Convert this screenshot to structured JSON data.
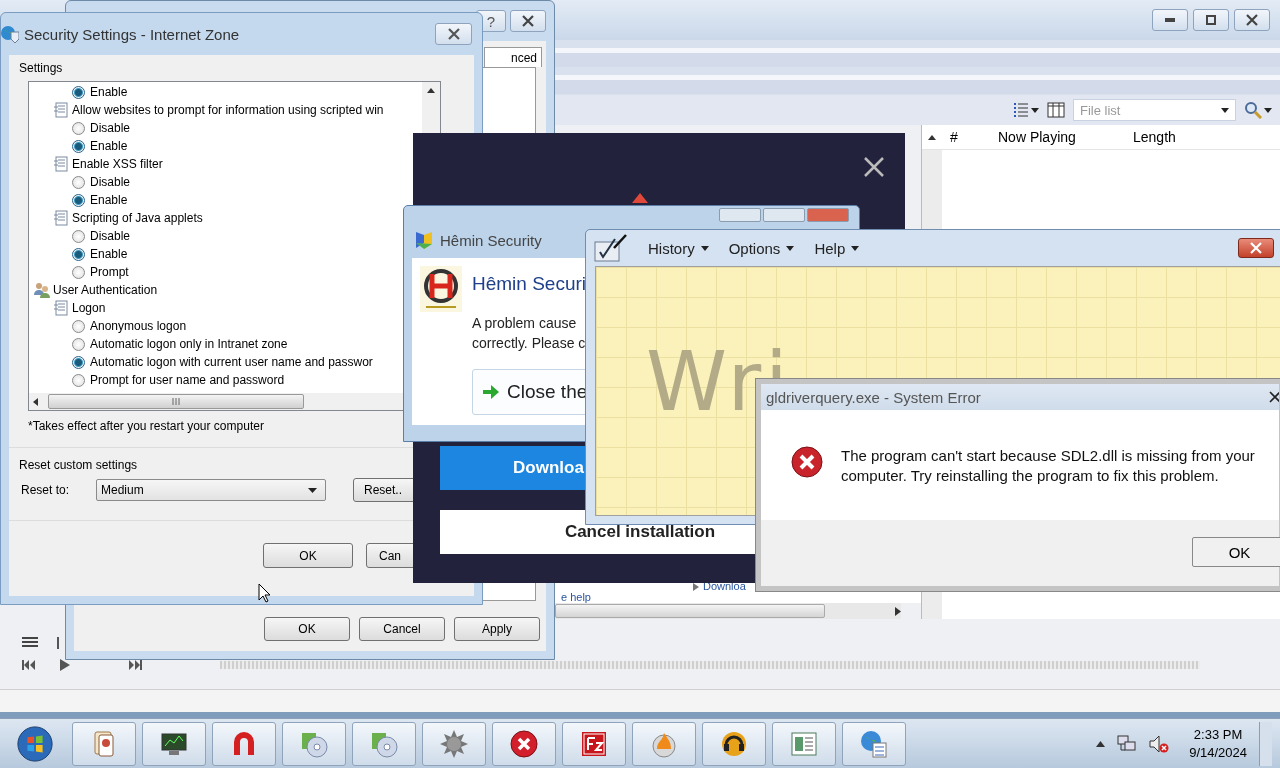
{
  "media_player": {
    "toolbar": {
      "list_field": {
        "placeholder": "File list"
      }
    },
    "playlist": {
      "columns": [
        "#",
        "Now Playing",
        "Length"
      ]
    },
    "pane_links": [
      "Downloa",
      "e help"
    ]
  },
  "internet_options": {
    "help_button": "?",
    "tab": "nced",
    "buttons": [
      "OK",
      "Cancel",
      "Apply"
    ]
  },
  "security_settings": {
    "title": "Security Settings - Internet Zone",
    "settings_label": "Settings",
    "tree": [
      {
        "kind": "category",
        "children": [
          {
            "kind": "setting",
            "children": [
              {
                "kind": "radio",
                "label": "Enable",
                "selected": true
              }
            ]
          },
          {
            "kind": "setting",
            "label": "Allow websites to prompt for information using scripted win",
            "children": [
              {
                "kind": "radio",
                "label": "Disable",
                "selected": false
              },
              {
                "kind": "radio",
                "label": "Enable",
                "selected": true
              }
            ]
          },
          {
            "kind": "setting",
            "label": "Enable XSS filter",
            "children": [
              {
                "kind": "radio",
                "label": "Disable",
                "selected": false
              },
              {
                "kind": "radio",
                "label": "Enable",
                "selected": true
              }
            ]
          },
          {
            "kind": "setting",
            "label": "Scripting of Java applets",
            "children": [
              {
                "kind": "radio",
                "label": "Disable",
                "selected": false
              },
              {
                "kind": "radio",
                "label": "Enable",
                "selected": true
              },
              {
                "kind": "radio",
                "label": "Prompt",
                "selected": false
              }
            ]
          }
        ]
      },
      {
        "kind": "category",
        "label": "User Authentication",
        "children": [
          {
            "kind": "setting",
            "label": "Logon",
            "children": [
              {
                "kind": "radio",
                "label": "Anonymous logon",
                "selected": false
              },
              {
                "kind": "radio",
                "label": "Automatic logon only in Intranet zone",
                "selected": false
              },
              {
                "kind": "radio",
                "label": "Automatic logon with current user name and passwor",
                "selected": true
              },
              {
                "kind": "radio",
                "label": "Prompt for user name and password",
                "selected": false
              }
            ]
          }
        ]
      }
    ],
    "note": "*Takes effect after you restart your computer",
    "reset_label": "Reset custom settings",
    "reset_to_label": "Reset to:",
    "reset_to_value": "Medium",
    "reset_button": "Reset..",
    "buttons": [
      "OK",
      "Can"
    ]
  },
  "installer": {
    "download_button": "Downloa",
    "cancel_button": "Cancel installation"
  },
  "hemin": {
    "title": "Hêmin Security",
    "heading": "Hêmin Securi",
    "message_lines": [
      "A problem cause",
      "correctly. Please c"
    ],
    "action_button": "Close the"
  },
  "math_input": {
    "menu": [
      "History",
      "Options",
      "Help"
    ],
    "ink_text": "Wri"
  },
  "error_dialog": {
    "title": "gldriverquery.exe - System Error",
    "message": "The program can't start because SDL2.dll is missing from your computer. Try reinstalling the program to fix this problem.",
    "button": "OK"
  },
  "taskbar": {
    "volume_muted": true,
    "time": "2:33 PM",
    "date": "9/14/2024"
  }
}
